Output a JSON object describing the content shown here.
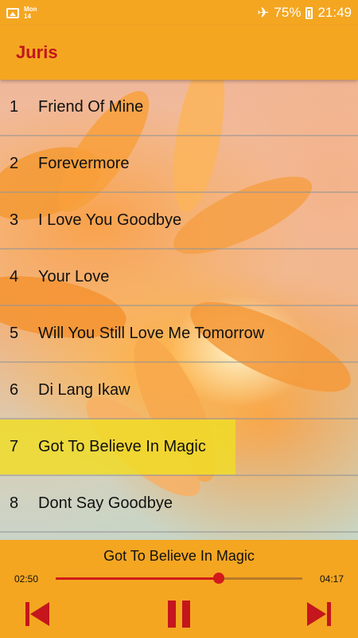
{
  "status_bar": {
    "date_day": "Mon",
    "date_num": "14",
    "battery": "75%",
    "time": "21:49",
    "icons": [
      "image-icon",
      "airplane-icon",
      "battery-icon"
    ]
  },
  "app_bar": {
    "title": "Juris"
  },
  "tracks": [
    {
      "num": "1",
      "title": "Friend Of Mine"
    },
    {
      "num": "2",
      "title": "Forevermore"
    },
    {
      "num": "3",
      "title": "I Love You Goodbye"
    },
    {
      "num": "4",
      "title": "Your Love"
    },
    {
      "num": "5",
      "title": "Will You Still Love Me Tomorrow"
    },
    {
      "num": "6",
      "title": "Di Lang Ikaw"
    },
    {
      "num": "7",
      "title": "Got To Believe In Magic",
      "active": true
    },
    {
      "num": "8",
      "title": "Dont Say Goodbye"
    }
  ],
  "player": {
    "now_playing": "Got To Believe In Magic",
    "current_time": "02:50",
    "total_time": "04:17",
    "progress_fraction": 0.66,
    "controls": [
      "previous-icon",
      "pause-icon",
      "next-icon"
    ]
  },
  "colors": {
    "accent": "#f4a621",
    "title_red": "#c0161d",
    "control_red": "#c4161c",
    "highlight": "#f0dc28"
  }
}
